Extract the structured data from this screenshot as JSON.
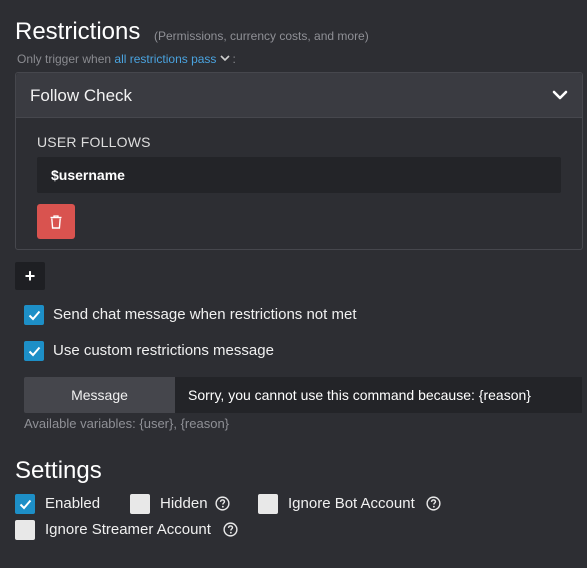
{
  "restrictions": {
    "title": "Restrictions",
    "subtitle": "(Permissions, currency costs, and more)",
    "trigger_prefix": "Only trigger when",
    "trigger_mode": "all restrictions pass",
    "trigger_suffix": ":",
    "card": {
      "title": "Follow Check",
      "field_label": "USER FOLLOWS",
      "field_value": "$username"
    },
    "add_label": "+",
    "options": {
      "send_chat": {
        "label": "Send chat message when restrictions not met",
        "checked": true
      },
      "custom_message": {
        "label": "Use custom restrictions message",
        "checked": true
      }
    },
    "message": {
      "addon_label": "Message",
      "value": "Sorry, you cannot use this command because: {reason}",
      "hint": "Available variables: {user}, {reason}"
    }
  },
  "settings": {
    "title": "Settings",
    "enabled": {
      "label": "Enabled",
      "checked": true
    },
    "hidden": {
      "label": "Hidden",
      "checked": false
    },
    "ignore_bot": {
      "label": "Ignore Bot Account",
      "checked": false
    },
    "ignore_streamer": {
      "label": "Ignore Streamer Account",
      "checked": false
    }
  },
  "icons": {
    "collapse": "chevron-down-icon",
    "delete": "trash-icon",
    "help": "question-circle-icon",
    "check": "check-icon"
  },
  "colors": {
    "background": "#2d2e33",
    "accent": "#1d8fc7",
    "link": "#4aa3df",
    "danger": "#d9534f",
    "input_bg": "#232428"
  }
}
